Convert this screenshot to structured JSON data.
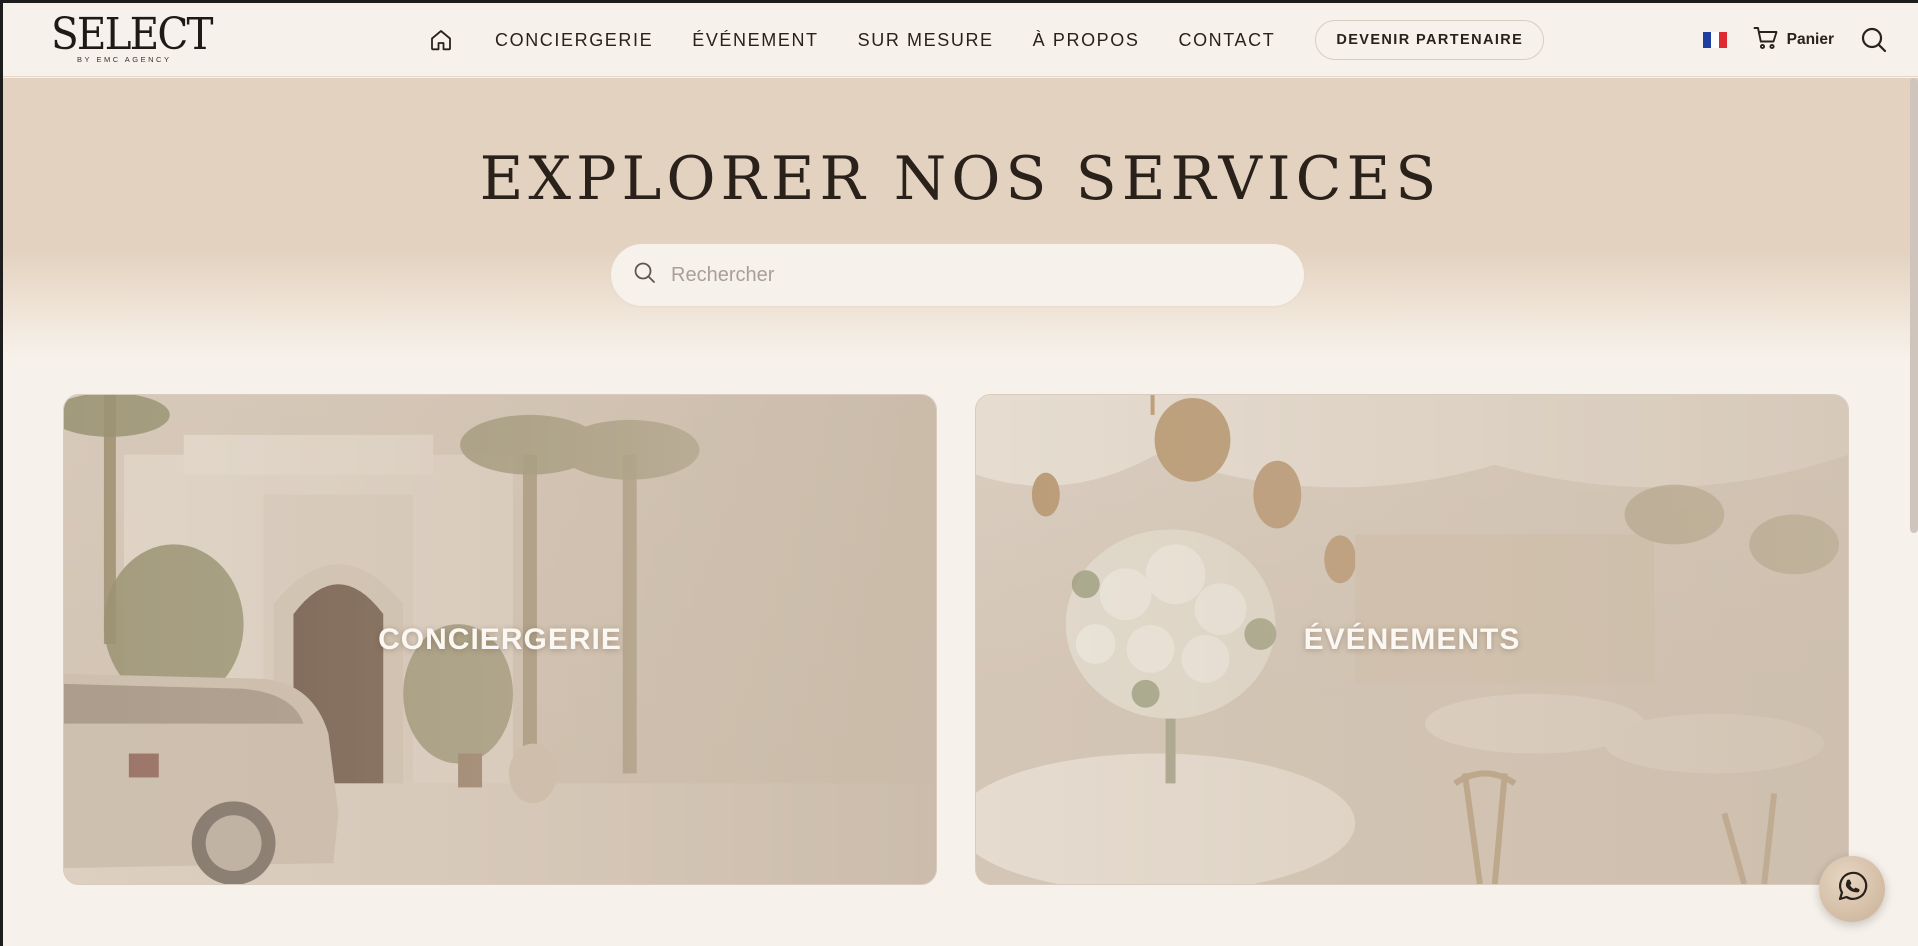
{
  "brand": {
    "name": "SELECT",
    "tagline": "BY EMC AGENCY"
  },
  "nav": {
    "home_icon": "home-icon",
    "links": [
      "CONCIERGERIE",
      "ÉVÉNEMENT",
      "SUR MESURE",
      "À PROPOS",
      "CONTACT"
    ],
    "partner_button": "DEVENIR PARTENAIRE"
  },
  "header_right": {
    "language_flag": "fr-flag",
    "cart_label": "Panier",
    "cart_icon": "cart-icon",
    "search_icon": "search-icon"
  },
  "hero": {
    "title": "EXPLORER NOS SERVICES",
    "search_placeholder": "Rechercher"
  },
  "cards": [
    {
      "label": "CONCIERGERIE"
    },
    {
      "label": "ÉVÉNEMENTS"
    }
  ],
  "floating": {
    "chat_icon": "whatsapp-icon"
  },
  "colors": {
    "background": "#f7f1eb",
    "hero_band": "#e3d2c0",
    "text": "#2a211b",
    "card_overlay": "#c8b8a6"
  }
}
